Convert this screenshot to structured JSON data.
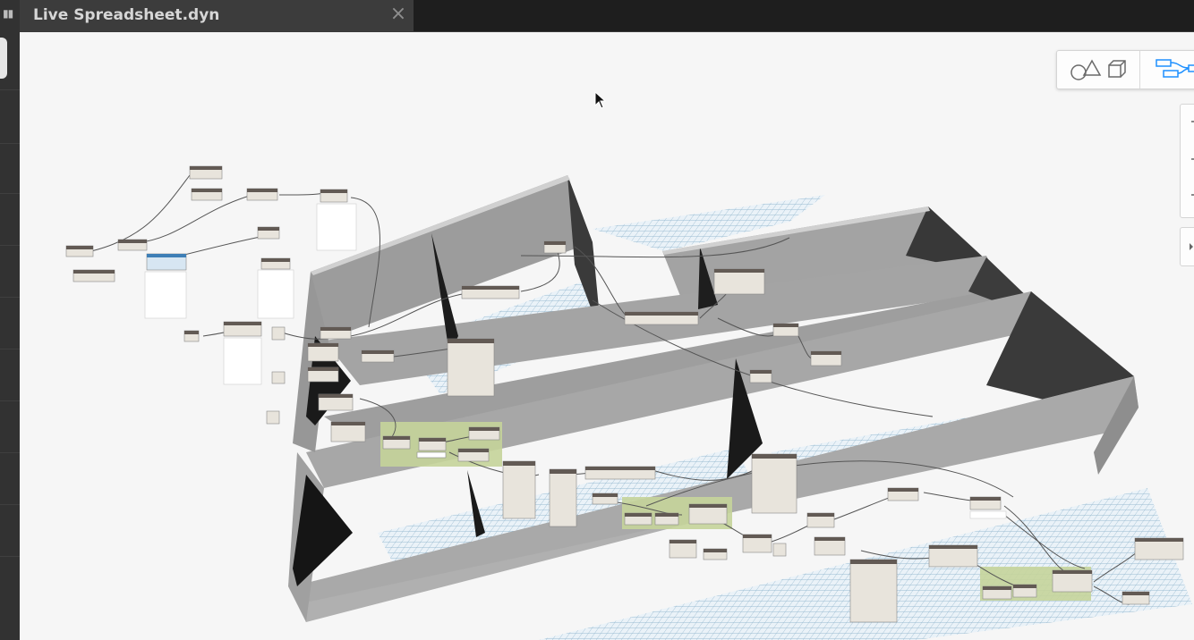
{
  "tab": {
    "title": "Live Spreadsheet.dyn",
    "close_glyph": "×"
  },
  "icons": {
    "rail_grip": "grip-icon",
    "tab_close": "close-icon",
    "geometry_view": "geometry-view-icon",
    "graph_view": "graph-view-icon",
    "cursor": "mouse-cursor-icon"
  },
  "colors": {
    "tab_bar": "#1e1e1e",
    "tab_active": "#3c3c3c",
    "canvas": "#f6f6f6",
    "wall": "#a8a8a8",
    "node_header": "#625a54",
    "node_body": "#e8e4dc",
    "group": "#c7d59b",
    "graph_accent": "#1e90ff"
  }
}
